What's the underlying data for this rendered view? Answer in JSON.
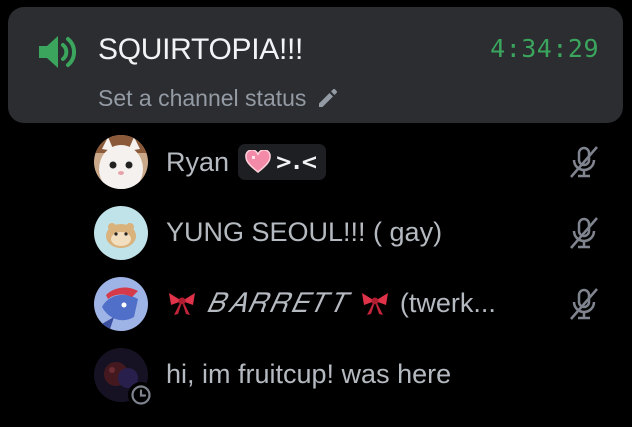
{
  "channel": {
    "name": "SQUIRTOPIA!!!",
    "timer": "4:34:29",
    "status_placeholder": "Set a channel status",
    "accent_color": "#3ba55d"
  },
  "users": [
    {
      "name": "Ryan",
      "tag_text": ">.<",
      "tag_icon": "pink-heart-icon",
      "muted": true,
      "avatar": "cat-avatar"
    },
    {
      "name": "YUNG SEOUL!!! ( gay)",
      "muted": true,
      "avatar": "hamster-avatar"
    },
    {
      "prefix_emoji": "ribbon",
      "name": "𝐵𝐴𝑅𝑅𝐸𝑇𝑇",
      "suffix_emoji": "ribbon",
      "name_suffix": "(twerk...",
      "muted": true,
      "avatar": "dragon-avatar"
    },
    {
      "name": "hi, im fruitcup! was here",
      "muted": false,
      "avatar": "fruitcup-avatar",
      "badge": "clock-icon"
    }
  ]
}
